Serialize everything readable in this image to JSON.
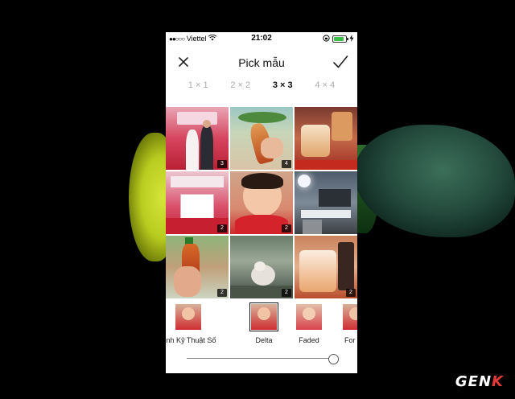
{
  "status_bar": {
    "carrier": "Viettel",
    "time": "21:02",
    "battery_level": 0.9
  },
  "nav": {
    "title": "Pick mẫu",
    "close_icon": "close-icon",
    "confirm_icon": "checkmark-icon"
  },
  "grid_tabs": [
    {
      "label": "1 × 1",
      "active": false
    },
    {
      "label": "2 × 2",
      "active": false
    },
    {
      "label": "3 × 3",
      "active": true
    },
    {
      "label": "4 × 4",
      "active": false
    }
  ],
  "photos": [
    {
      "badge": "3",
      "desc": "wedding couple"
    },
    {
      "badge": "4",
      "desc": "drink bottle in hand"
    },
    {
      "badge": "",
      "desc": "iced tea glasses"
    },
    {
      "badge": "2",
      "desc": "wedding hall"
    },
    {
      "badge": "2",
      "desc": "child in red"
    },
    {
      "badge": "",
      "desc": "office desk"
    },
    {
      "badge": "2",
      "desc": "bottle on street"
    },
    {
      "badge": "2",
      "desc": "cat on ground"
    },
    {
      "badge": "2",
      "desc": "iced tea glass"
    }
  ],
  "filters": [
    {
      "label": "g Minh Kỹ Thuật Số",
      "selected": false
    },
    {
      "label": "Delta",
      "selected": true
    },
    {
      "label": "Faded",
      "selected": false
    },
    {
      "label": "For",
      "selected": false
    }
  ],
  "slider": {
    "value": 1.0
  },
  "watermark": {
    "text_main": "GEN",
    "text_accent": "K"
  }
}
